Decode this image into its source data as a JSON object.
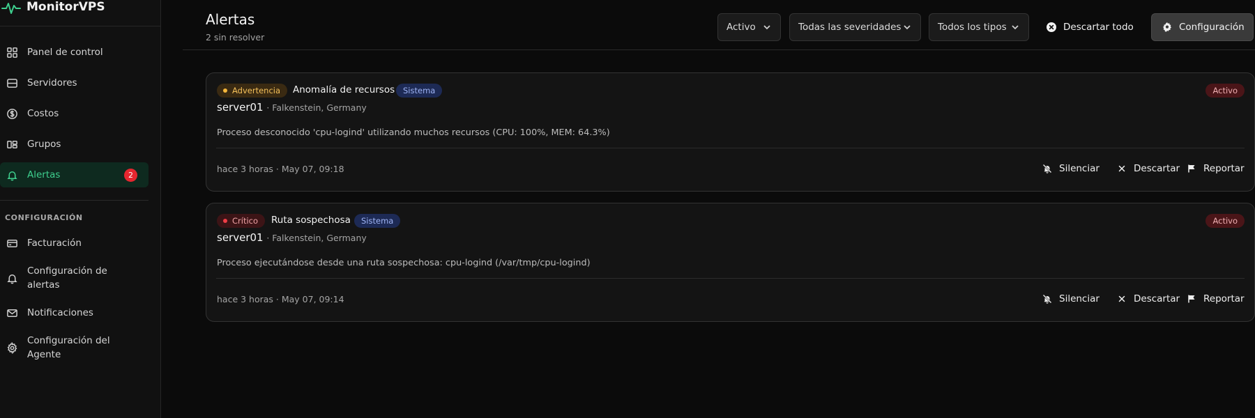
{
  "app": {
    "name": "MonitorVPS",
    "accent": "#3ecf8e"
  },
  "sidebar": {
    "items": [
      {
        "label": "Panel de control",
        "icon": "dashboard-icon"
      },
      {
        "label": "Servidores",
        "icon": "server-icon"
      },
      {
        "label": "Costos",
        "icon": "dollar-icon"
      },
      {
        "label": "Grupos",
        "icon": "groups-icon"
      },
      {
        "label": "Alertas",
        "icon": "bell-icon",
        "badge": "2",
        "active": true
      }
    ],
    "section_label": "CONFIGURACIÓN",
    "config_items": [
      {
        "label": "Facturación",
        "icon": "credit-card-icon"
      },
      {
        "label": "Configuración de alertas",
        "icon": "bell-icon"
      },
      {
        "label": "Notificaciones",
        "icon": "mail-icon"
      },
      {
        "label": "Configuración del Agente",
        "icon": "gear-icon"
      }
    ]
  },
  "header": {
    "title": "Alertas",
    "subtitle": "2 sin resolver",
    "filters": {
      "status": "Activo",
      "severity": "Todas las severidades",
      "type": "Todos los tipos"
    },
    "dismiss_all": "Descartar todo",
    "config": "Configuración"
  },
  "alerts": [
    {
      "severity": "Advertencia",
      "severity_color": "#f5b73b",
      "title": "Anomalía de recursos",
      "tag": "Sistema",
      "status": "Activo",
      "server": "server01",
      "location": "· Falkenstein, Germany",
      "description": "Proceso desconocido 'cpu-logind' utilizando muchos recursos (CPU: 100%, MEM: 64.3%)",
      "time": "hace 3 horas · May 07, 09:18",
      "actions": {
        "mute": "Silenciar",
        "dismiss": "Descartar",
        "report": "Reportar"
      }
    },
    {
      "severity": "Crítico",
      "severity_color": "#ef3d46",
      "title": "Ruta sospechosa",
      "tag": "Sistema",
      "status": "Activo",
      "server": "server01",
      "location": "· Falkenstein, Germany",
      "description": "Proceso ejecutándose desde una ruta sospechosa: cpu-logind (/var/tmp/cpu-logind)",
      "time": "hace 3 horas · May 07, 09:14",
      "actions": {
        "mute": "Silenciar",
        "dismiss": "Descartar",
        "report": "Reportar"
      }
    }
  ]
}
